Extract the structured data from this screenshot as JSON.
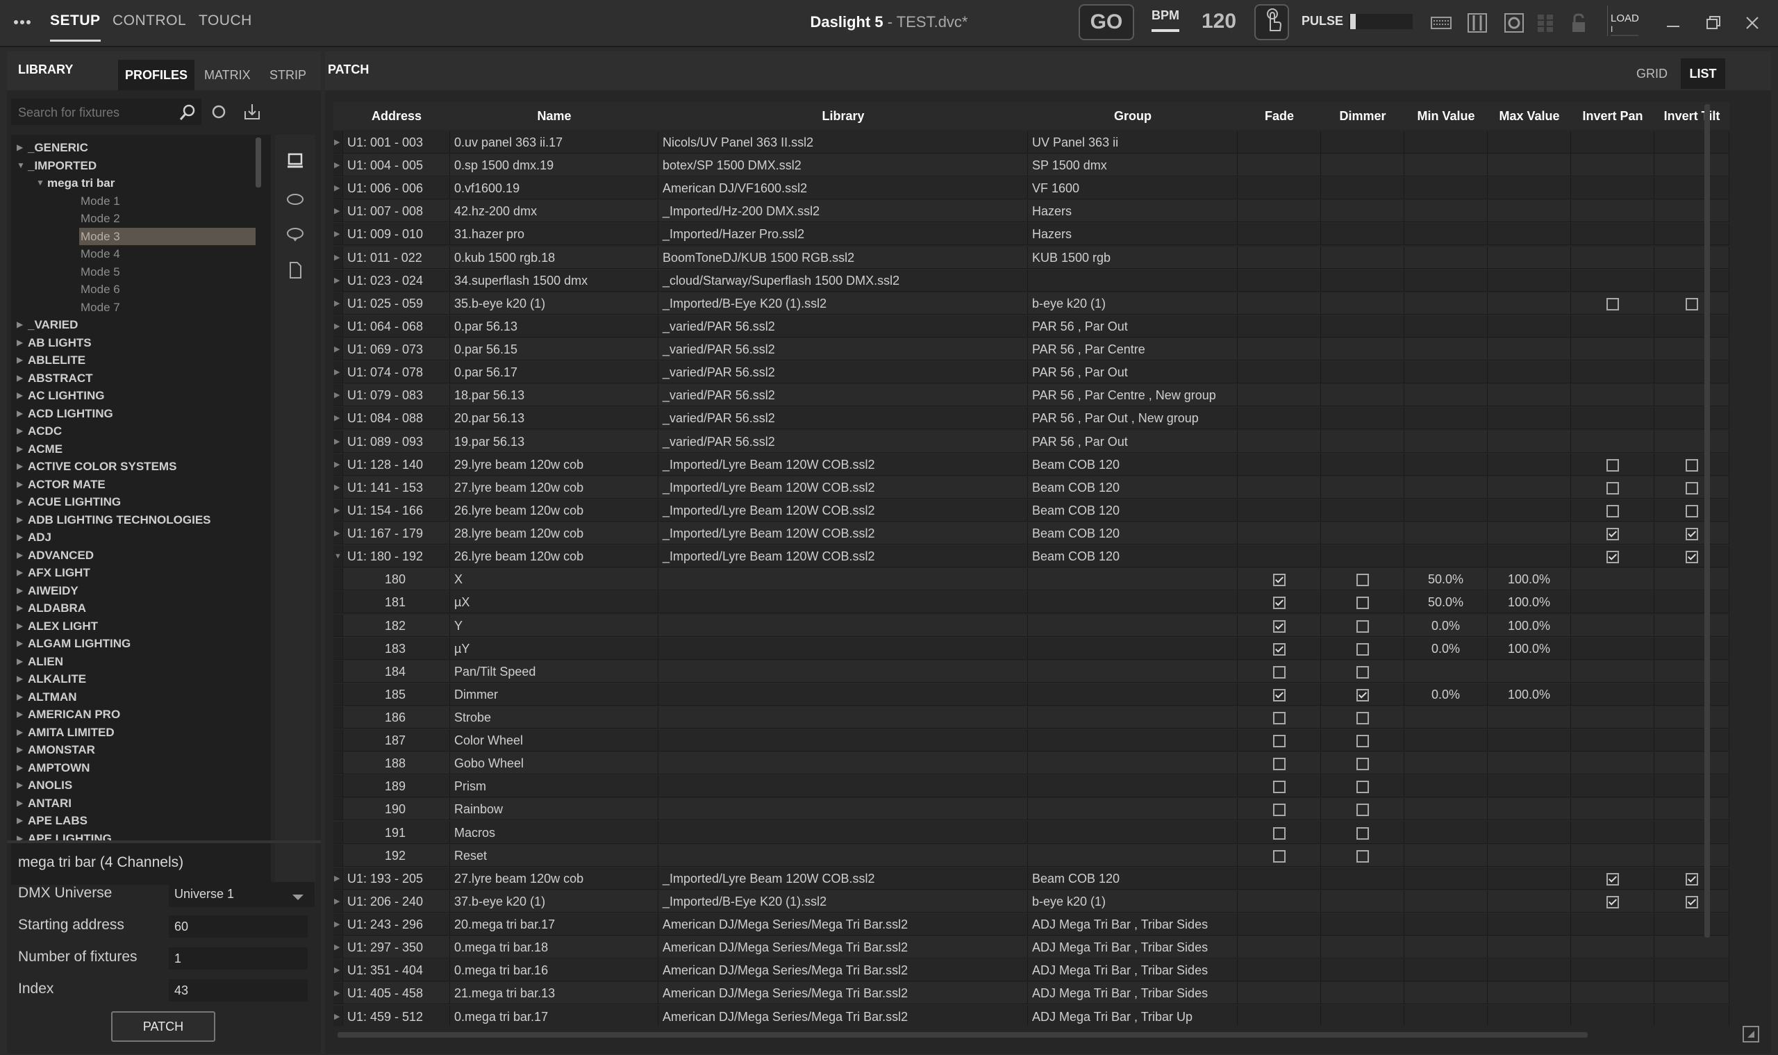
{
  "topbar": {
    "menu_icon": "more-dots-icon",
    "nav": [
      "SETUP",
      "CONTROL",
      "TOUCH"
    ],
    "app_name": "Daslight 5",
    "separator": " - ",
    "file_name": "TEST.dvc*",
    "go_label": "GO",
    "bpm_label": "BPM",
    "bpm_value": "120",
    "pulse_label": "PULSE",
    "load_label": "LOAD",
    "load_value": "I"
  },
  "library": {
    "header": "LIBRARY",
    "tabs": [
      "PROFILES",
      "MATRIX",
      "STRIP"
    ],
    "active_tab": "PROFILES",
    "search_placeholder": "Search for fixtures",
    "tree": [
      {
        "label": "_GENERIC",
        "level": 0,
        "expanded": false
      },
      {
        "label": "_IMPORTED",
        "level": 0,
        "expanded": true
      },
      {
        "label": "mega tri bar",
        "level": 1,
        "expanded": true
      },
      {
        "label": "Mode 1",
        "level": 2
      },
      {
        "label": "Mode 2",
        "level": 2
      },
      {
        "label": "Mode 3",
        "level": 2,
        "selected": true
      },
      {
        "label": "Mode 4",
        "level": 2
      },
      {
        "label": "Mode 5",
        "level": 2
      },
      {
        "label": "Mode 6",
        "level": 2
      },
      {
        "label": "Mode 7",
        "level": 2
      },
      {
        "label": "_VARIED",
        "level": 0
      },
      {
        "label": "AB LIGHTS",
        "level": 0
      },
      {
        "label": "ABLELITE",
        "level": 0
      },
      {
        "label": "ABSTRACT",
        "level": 0
      },
      {
        "label": "AC LIGHTING",
        "level": 0
      },
      {
        "label": "ACD LIGHTING",
        "level": 0
      },
      {
        "label": "ACDC",
        "level": 0
      },
      {
        "label": "ACME",
        "level": 0
      },
      {
        "label": "ACTIVE COLOR SYSTEMS",
        "level": 0
      },
      {
        "label": "ACTOR MATE",
        "level": 0
      },
      {
        "label": "ACUE LIGHTING",
        "level": 0
      },
      {
        "label": "ADB LIGHTING TECHNOLOGIES",
        "level": 0
      },
      {
        "label": "ADJ",
        "level": 0
      },
      {
        "label": "ADVANCED",
        "level": 0
      },
      {
        "label": "AFX LIGHT",
        "level": 0
      },
      {
        "label": "AIWEIDY",
        "level": 0
      },
      {
        "label": "ALDABRA",
        "level": 0
      },
      {
        "label": "ALEX LIGHT",
        "level": 0
      },
      {
        "label": "ALGAM LIGHTING",
        "level": 0
      },
      {
        "label": "ALIEN",
        "level": 0
      },
      {
        "label": "ALKALITE",
        "level": 0
      },
      {
        "label": "ALTMAN",
        "level": 0
      },
      {
        "label": "AMERICAN PRO",
        "level": 0
      },
      {
        "label": "AMITA LIMITED",
        "level": 0
      },
      {
        "label": "AMONSTAR",
        "level": 0
      },
      {
        "label": "AMPTOWN",
        "level": 0
      },
      {
        "label": "ANOLIS",
        "level": 0
      },
      {
        "label": "ANTARI",
        "level": 0
      },
      {
        "label": "APE LABS",
        "level": 0
      },
      {
        "label": "APE LIGHTING",
        "level": 0
      }
    ],
    "fixture_info": "mega tri bar (4 Channels)",
    "form": {
      "universe_label": "DMX Universe",
      "universe_value": "Universe 1",
      "start_label": "Starting address",
      "start_value": "60",
      "count_label": "Number of fixtures",
      "count_value": "1",
      "index_label": "Index",
      "index_value": "43",
      "patch_button": "PATCH"
    }
  },
  "patch": {
    "header": "PATCH",
    "view_tabs": [
      "GRID",
      "LIST"
    ],
    "active_view": "LIST",
    "columns": [
      "Address",
      "Name",
      "Library",
      "Group",
      "Fade",
      "Dimmer",
      "Min Value",
      "Max Value",
      "Invert Pan",
      "Invert Tilt"
    ],
    "rows": [
      {
        "type": "fixture",
        "address": "U1: 001 - 003",
        "name": "0.uv panel 363 ii.17",
        "library": "Nicols/UV Panel 363 II.ssl2",
        "group": "UV Panel 363 ii"
      },
      {
        "type": "fixture",
        "address": "U1: 004 - 005",
        "name": "0.sp 1500 dmx.19",
        "library": "botex/SP 1500 DMX.ssl2",
        "group": "SP 1500 dmx"
      },
      {
        "type": "fixture",
        "address": "U1: 006 - 006",
        "name": "0.vf1600.19",
        "library": "American DJ/VF1600.ssl2",
        "group": "VF 1600"
      },
      {
        "type": "fixture",
        "address": "U1: 007 - 008",
        "name": "42.hz-200 dmx",
        "library": "_Imported/Hz-200 DMX.ssl2",
        "group": "Hazers"
      },
      {
        "type": "fixture",
        "address": "U1: 009 - 010",
        "name": "31.hazer pro",
        "library": "_Imported/Hazer Pro.ssl2",
        "group": "Hazers"
      },
      {
        "type": "fixture",
        "address": "U1: 011 - 022",
        "name": "0.kub 1500 rgb.18",
        "library": "BoomToneDJ/KUB 1500 RGB.ssl2",
        "group": "KUB 1500 rgb"
      },
      {
        "type": "fixture",
        "address": "U1: 023 - 024",
        "name": "34.superflash 1500 dmx",
        "library": "_cloud/Starway/Superflash 1500 DMX.ssl2",
        "group": ""
      },
      {
        "type": "fixture",
        "address": "U1: 025 - 059",
        "name": "35.b-eye k20 (1)",
        "library": "_Imported/B-Eye K20 (1).ssl2",
        "group": "b-eye k20 (1)",
        "invert_pan": false,
        "invert_tilt": false
      },
      {
        "type": "fixture",
        "address": "U1: 064 - 068",
        "name": "0.par 56.13",
        "library": "_varied/PAR 56.ssl2",
        "group": "PAR 56 , Par Out"
      },
      {
        "type": "fixture",
        "address": "U1: 069 - 073",
        "name": "0.par 56.15",
        "library": "_varied/PAR 56.ssl2",
        "group": "PAR 56 , Par Centre"
      },
      {
        "type": "fixture",
        "address": "U1: 074 - 078",
        "name": "0.par 56.17",
        "library": "_varied/PAR 56.ssl2",
        "group": "PAR 56 , Par Out"
      },
      {
        "type": "fixture",
        "address": "U1: 079 - 083",
        "name": "18.par 56.13",
        "library": "_varied/PAR 56.ssl2",
        "group": "PAR 56 , Par Centre , New group"
      },
      {
        "type": "fixture",
        "address": "U1: 084 - 088",
        "name": "20.par 56.13",
        "library": "_varied/PAR 56.ssl2",
        "group": "PAR 56 , Par Out , New group"
      },
      {
        "type": "fixture",
        "address": "U1: 089 - 093",
        "name": "19.par 56.13",
        "library": "_varied/PAR 56.ssl2",
        "group": "PAR 56 , Par Out"
      },
      {
        "type": "fixture",
        "address": "U1: 128 - 140",
        "name": "29.lyre beam 120w cob",
        "library": "_Imported/Lyre Beam 120W COB.ssl2",
        "group": "Beam COB 120",
        "invert_pan": false,
        "invert_tilt": false
      },
      {
        "type": "fixture",
        "address": "U1: 141 - 153",
        "name": "27.lyre beam 120w cob",
        "library": "_Imported/Lyre Beam 120W COB.ssl2",
        "group": "Beam COB 120",
        "invert_pan": false,
        "invert_tilt": false
      },
      {
        "type": "fixture",
        "address": "U1: 154 - 166",
        "name": "26.lyre beam 120w cob",
        "library": "_Imported/Lyre Beam 120W COB.ssl2",
        "group": "Beam COB 120",
        "invert_pan": false,
        "invert_tilt": false
      },
      {
        "type": "fixture",
        "address": "U1: 167 - 179",
        "name": "28.lyre beam 120w cob",
        "library": "_Imported/Lyre Beam 120W COB.ssl2",
        "group": "Beam COB 120",
        "invert_pan": true,
        "invert_tilt": true
      },
      {
        "type": "fixture",
        "expanded": true,
        "address": "U1: 180 - 192",
        "name": "26.lyre beam 120w cob",
        "library": "_Imported/Lyre Beam 120W COB.ssl2",
        "group": "Beam COB 120",
        "invert_pan": true,
        "invert_tilt": true
      },
      {
        "type": "channel",
        "address": "180",
        "name": "X",
        "fade": true,
        "dimmer": false,
        "min": "50.0%",
        "max": "100.0%"
      },
      {
        "type": "channel",
        "address": "181",
        "name": "µX",
        "fade": true,
        "dimmer": false,
        "min": "50.0%",
        "max": "100.0%"
      },
      {
        "type": "channel",
        "address": "182",
        "name": "Y",
        "fade": true,
        "dimmer": false,
        "min": "0.0%",
        "max": "100.0%"
      },
      {
        "type": "channel",
        "address": "183",
        "name": "µY",
        "fade": true,
        "dimmer": false,
        "min": "0.0%",
        "max": "100.0%"
      },
      {
        "type": "channel",
        "address": "184",
        "name": "Pan/Tilt Speed",
        "fade": false,
        "dimmer": false
      },
      {
        "type": "channel",
        "address": "185",
        "name": "Dimmer",
        "fade": true,
        "dimmer": true,
        "min": "0.0%",
        "max": "100.0%"
      },
      {
        "type": "channel",
        "address": "186",
        "name": "Strobe",
        "fade": false,
        "dimmer": false
      },
      {
        "type": "channel",
        "address": "187",
        "name": "Color Wheel",
        "fade": false,
        "dimmer": false
      },
      {
        "type": "channel",
        "address": "188",
        "name": "Gobo Wheel",
        "fade": false,
        "dimmer": false
      },
      {
        "type": "channel",
        "address": "189",
        "name": "Prism",
        "fade": false,
        "dimmer": false
      },
      {
        "type": "channel",
        "address": "190",
        "name": "Rainbow",
        "fade": false,
        "dimmer": false
      },
      {
        "type": "channel",
        "address": "191",
        "name": "Macros",
        "fade": false,
        "dimmer": false
      },
      {
        "type": "channel",
        "address": "192",
        "name": "Reset",
        "fade": false,
        "dimmer": false
      },
      {
        "type": "fixture",
        "address": "U1: 193 - 205",
        "name": "27.lyre beam 120w cob",
        "library": "_Imported/Lyre Beam 120W COB.ssl2",
        "group": "Beam COB 120",
        "invert_pan": true,
        "invert_tilt": true
      },
      {
        "type": "fixture",
        "address": "U1: 206 - 240",
        "name": "37.b-eye k20 (1)",
        "library": "_Imported/B-Eye K20 (1).ssl2",
        "group": "b-eye k20 (1)",
        "invert_pan": true,
        "invert_tilt": true
      },
      {
        "type": "fixture",
        "address": "U1: 243 - 296",
        "name": "20.mega tri bar.17",
        "library": "American DJ/Mega Series/Mega Tri Bar.ssl2",
        "group": "ADJ Mega Tri Bar , Tribar Sides"
      },
      {
        "type": "fixture",
        "address": "U1: 297 - 350",
        "name": "0.mega tri bar.18",
        "library": "American DJ/Mega Series/Mega Tri Bar.ssl2",
        "group": "ADJ Mega Tri Bar , Tribar Sides"
      },
      {
        "type": "fixture",
        "address": "U1: 351 - 404",
        "name": "0.mega tri bar.16",
        "library": "American DJ/Mega Series/Mega Tri Bar.ssl2",
        "group": "ADJ Mega Tri Bar , Tribar Sides"
      },
      {
        "type": "fixture",
        "address": "U1: 405 - 458",
        "name": "21.mega tri bar.13",
        "library": "American DJ/Mega Series/Mega Tri Bar.ssl2",
        "group": "ADJ Mega Tri Bar , Tribar Sides"
      },
      {
        "type": "fixture",
        "address": "U1: 459 - 512",
        "name": "0.mega tri bar.17",
        "library": "American DJ/Mega Series/Mega Tri Bar.ssl2",
        "group": "ADJ Mega Tri Bar , Tribar Up"
      }
    ]
  }
}
